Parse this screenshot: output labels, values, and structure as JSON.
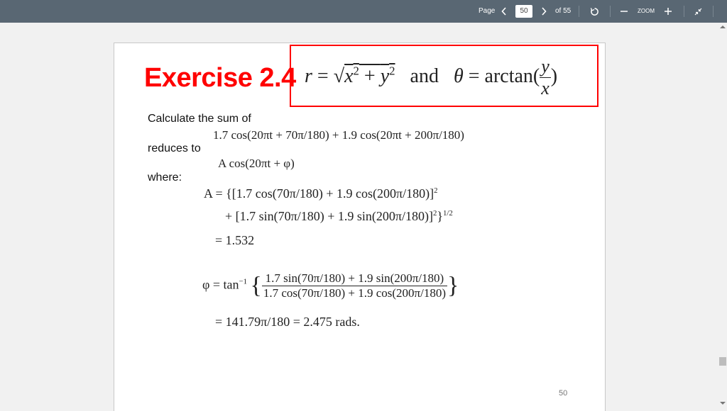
{
  "toolbar": {
    "page_label": "Page",
    "current_page": "50",
    "total_pages_label": "of 55",
    "zoom_label": "ZOOM",
    "icons": {
      "prev": "chevron-left-icon",
      "next": "chevron-right-icon",
      "rotate": "rotate-icon",
      "zoom_out": "minus-icon",
      "zoom_in": "plus-icon",
      "collapse": "collapse-arrows-icon"
    },
    "background_color": "#596773"
  },
  "document": {
    "exercise_title": "Exercise 2.4",
    "title_color": "#ff0000",
    "boxed_formula": {
      "r_part": "r = √(x² + y²)",
      "and": "and",
      "theta_part": "θ = arctan(y/x)"
    },
    "text_calculate": "Calculate the sum of",
    "sum_expression": "1.7 cos(20πt + 70π/180) + 1.9 cos(20πt + 200π/180)",
    "text_reduces": "reduces to",
    "reduced_expression": "A cos(20πt + φ)",
    "text_where": "where:",
    "A_line1": "A = {[1.7 cos(70π/180) + 1.9 cos(200π/180)]",
    "A_line2": "+ [1.7 sin(70π/180) + 1.9 sin(200π/180)]",
    "A_result": "= 1.532",
    "phi_prefix": "φ = tan",
    "phi_numerator": "1.7 sin(70π/180) + 1.9 sin(200π/180)",
    "phi_denominator": "1.7 cos(70π/180) + 1.9 cos(200π/180)",
    "phi_result": "= 141.79π/180 = 2.475 rads.",
    "page_number": "50"
  }
}
